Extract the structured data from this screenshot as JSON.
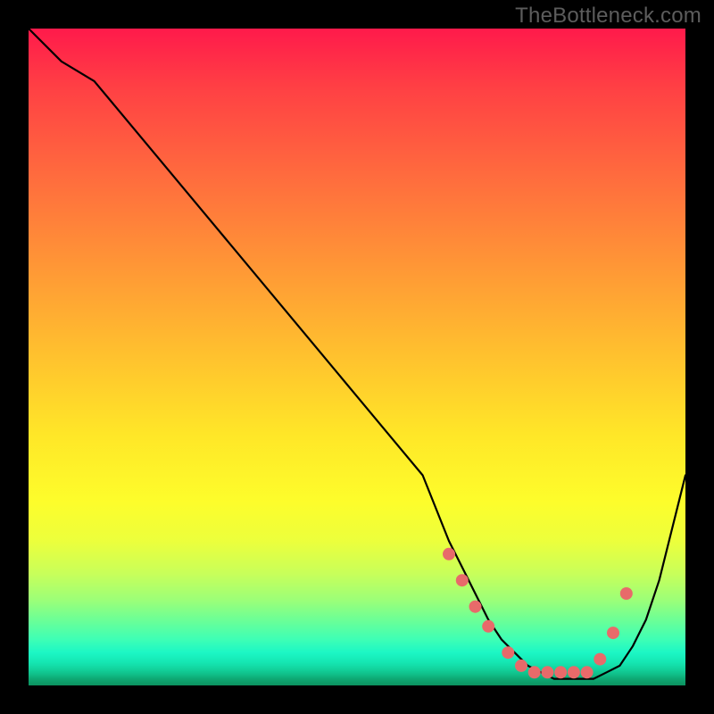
{
  "watermark": "TheBottleneck.com",
  "chart_data": {
    "type": "line",
    "title": "",
    "xlabel": "",
    "ylabel": "",
    "xlim": [
      0,
      100
    ],
    "ylim": [
      0,
      100
    ],
    "series": [
      {
        "name": "bottleneck-curve",
        "x": [
          0,
          5,
          10,
          20,
          30,
          40,
          50,
          60,
          64,
          66,
          68,
          70,
          72,
          74,
          76,
          78,
          80,
          82,
          84,
          86,
          88,
          90,
          92,
          94,
          96,
          98,
          100
        ],
        "y": [
          100,
          95,
          92,
          80,
          68,
          56,
          44,
          32,
          22,
          18,
          14,
          10,
          7,
          5,
          3,
          2,
          1,
          1,
          1,
          1,
          2,
          3,
          6,
          10,
          16,
          24,
          32
        ]
      }
    ],
    "markers": {
      "name": "highlight-dots",
      "color": "#e86a6a",
      "x": [
        64,
        66,
        68,
        70,
        73,
        75,
        77,
        79,
        81,
        83,
        85,
        87,
        89,
        91
      ],
      "y": [
        20,
        16,
        12,
        9,
        5,
        3,
        2,
        2,
        2,
        2,
        2,
        4,
        8,
        14
      ]
    }
  }
}
